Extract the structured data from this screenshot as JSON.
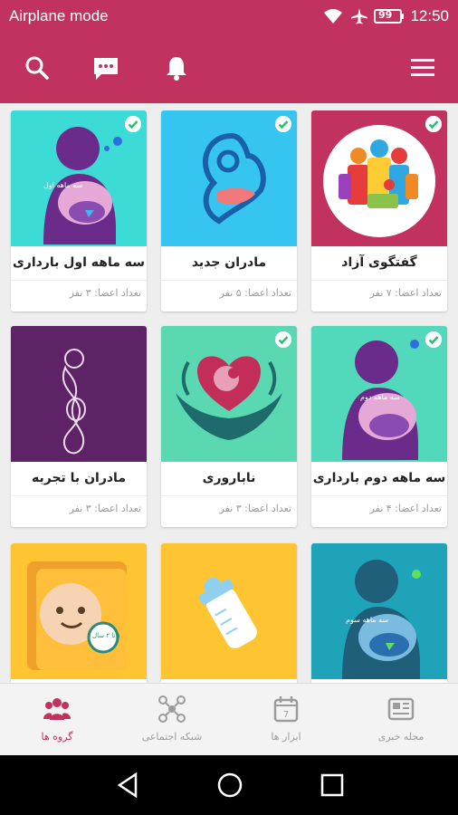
{
  "status_bar": {
    "title": "Airplane mode",
    "battery": "99",
    "time": "12:50",
    "icons": [
      "wifi-icon",
      "airplane-icon",
      "battery-icon"
    ]
  },
  "toolbar": {
    "icons": [
      "search-icon",
      "chat-icon",
      "bell-icon",
      "menu-icon"
    ]
  },
  "groups": [
    {
      "name": "گفتگوی آزاد",
      "members": "تعداد اعضا: ۷ نفر",
      "checked": true,
      "bg": "#c2325f"
    },
    {
      "name": "مادران جدید",
      "members": "تعداد اعضا: ۵ نفر",
      "checked": true,
      "bg": "#35c5f0"
    },
    {
      "name": "سه ماهه اول بارداری",
      "members": "تعداد اعضا: ۳ نفر",
      "checked": true,
      "bg": "#3ddbd6",
      "art_text": "سه ماهه اول"
    },
    {
      "name": "سه ماهه دوم بارداری",
      "members": "تعداد اعضا: ۴ نفر",
      "checked": true,
      "bg": "#52d8ba",
      "art_text": "سه ماهه دوم"
    },
    {
      "name": "ناباروری",
      "members": "تعداد اعضا: ۳ نفر",
      "checked": true,
      "bg": "#5ad8b2"
    },
    {
      "name": "مادران با تجربه",
      "members": "تعداد اعضا: ۳ نفر",
      "checked": false,
      "bg": "#5e2267"
    },
    {
      "name": "",
      "members": "",
      "checked": false,
      "bg": "#1fa3b8",
      "art_text": "سه ماهه سوم"
    },
    {
      "name": "",
      "members": "",
      "checked": false,
      "bg": "#ffc432"
    },
    {
      "name": "",
      "members": "",
      "checked": false,
      "bg": "#ffc432",
      "art_text": "۱ تا ۲ سال"
    }
  ],
  "bottom_nav": [
    {
      "label": "مجله خبری",
      "icon": "newspaper-icon",
      "active": false
    },
    {
      "label": "ابزار ها",
      "icon": "calendar-tools-icon",
      "active": false
    },
    {
      "label": "شبکه اجتماعی",
      "icon": "social-network-icon",
      "active": false
    },
    {
      "label": "گروه ها",
      "icon": "groups-icon",
      "active": true
    }
  ],
  "colors": {
    "primary": "#c2325f",
    "check": "#2ebd74",
    "inactive_nav": "#9c9c9c"
  }
}
